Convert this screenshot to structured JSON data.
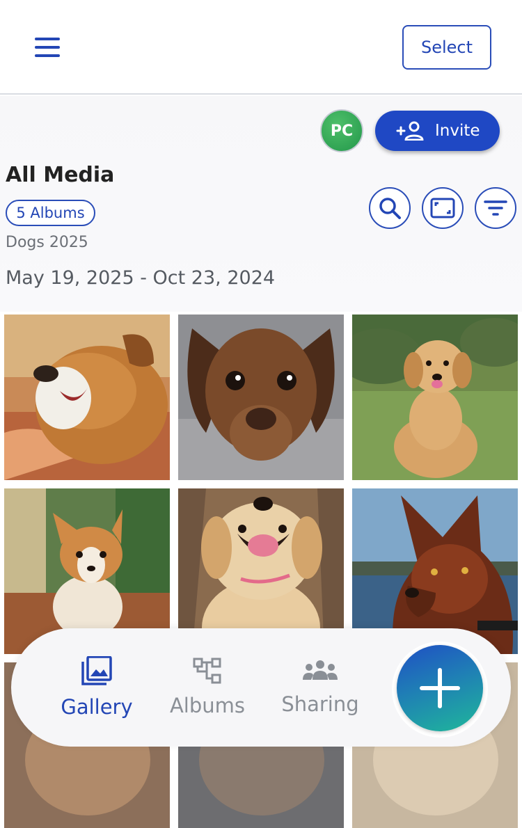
{
  "topbar": {
    "select_label": "Select"
  },
  "header": {
    "avatar_initials": "PC",
    "invite_label": "Invite",
    "title": "All Media",
    "albums_count": "5 Albums",
    "subtitle": "Dogs 2025",
    "date_range": "May 19, 2025 - Oct 23, 2024"
  },
  "photos": [
    {
      "name": "tan-puppy-yawning"
    },
    {
      "name": "dachshund-puppy"
    },
    {
      "name": "golden-retriever-puppy-grass"
    },
    {
      "name": "corgi-puppy"
    },
    {
      "name": "smiling-golden-puppy"
    },
    {
      "name": "brown-shepherd-by-water"
    }
  ],
  "nav": {
    "items": [
      {
        "label": "Gallery",
        "icon": "gallery-icon",
        "active": true
      },
      {
        "label": "Albums",
        "icon": "albums-tree-icon",
        "active": false
      },
      {
        "label": "Sharing",
        "icon": "people-icon",
        "active": false
      }
    ],
    "fab_icon": "plus-icon"
  },
  "colors": {
    "accent": "#2346b5",
    "avatar": "#2f9a4f",
    "fab_start": "#1f4fc4",
    "fab_end": "#1fb89a"
  }
}
